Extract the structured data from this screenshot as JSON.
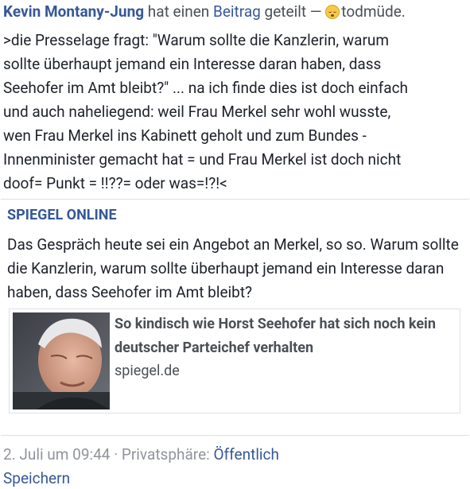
{
  "header": {
    "author": "Kevin Montany-Jung",
    "text_before_link": " hat einen ",
    "post_link": "Beitrag",
    "text_after_link": " geteilt — ",
    "feeling_icon": "sleepy-face-emoji",
    "feeling": "todmüde."
  },
  "post": {
    "text": ">die Presselage fragt: \"Warum sollte die Kanzlerin, warum\nsollte überhaupt jemand ein Interesse daran haben, dass\nSeehofer im Amt bleibt?\" ... na ich finde dies ist doch einfach\nund auch naheliegend: weil Frau Merkel sehr wohl wusste,\nwen Frau Merkel ins Kabinett geholt und zum Bundes -\nInnenminister gemacht hat = und Frau Merkel ist doch nicht\ndoof= Punkt = !!??= oder was=!?!<"
  },
  "shared": {
    "page_name": "SPIEGEL ONLINE",
    "text": "Das Gespräch heute sei ein Angebot an Merkel, so so. Warum sollte die Kanzlerin, warum sollte überhaupt jemand ein Interesse daran haben, dass Seehofer im Amt bleibt?",
    "card": {
      "title": "So kindisch wie Horst Seehofer hat sich noch kein deutscher Parteichef verhalten",
      "domain": "spiegel.de"
    }
  },
  "meta": {
    "date": "2. Juli um 09:44",
    "separator": " · ",
    "privacy_label": "Privatsphäre: ",
    "privacy_value": "Öffentlich"
  },
  "actions": {
    "save": "Speichern"
  },
  "colors": {
    "link_blue": "#365899",
    "text": "#1d2129",
    "meta_gray": "#90949c",
    "border": "#dddfe2"
  }
}
